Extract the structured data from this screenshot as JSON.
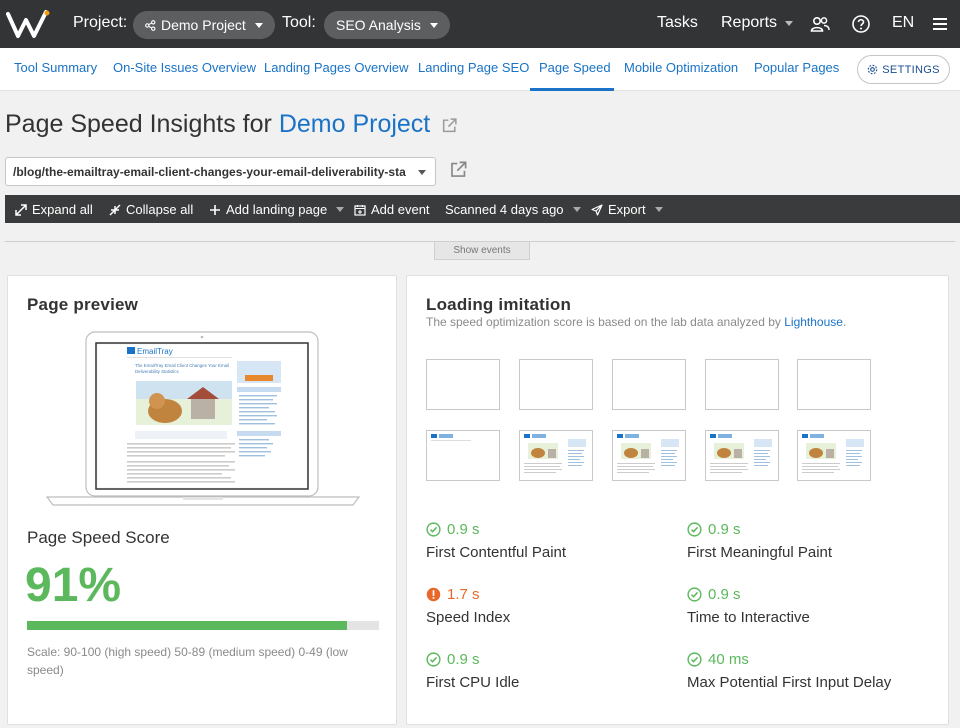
{
  "topbar": {
    "project_label": "Project:",
    "project_value": "Demo Project",
    "tool_label": "Tool:",
    "tool_value": "SEO Analysis",
    "tasks": "Tasks",
    "reports": "Reports",
    "language": "EN"
  },
  "tabs": [
    {
      "label": "Tool Summary"
    },
    {
      "label": "On-Site Issues Overview"
    },
    {
      "label": "Landing Pages Overview"
    },
    {
      "label": "Landing Page SEO"
    },
    {
      "label": "Page Speed"
    },
    {
      "label": "Mobile Optimization"
    },
    {
      "label": "Popular Pages"
    }
  ],
  "active_tab": "Page Speed",
  "settings_label": "SETTINGS",
  "heading": {
    "prefix": "Page Speed Insights for",
    "project": "Demo Project"
  },
  "url_select": {
    "value": "/blog/the-emailtray-email-client-changes-your-email-deliverability-sta"
  },
  "toolbar": {
    "expand_all": "Expand all",
    "collapse_all": "Collapse all",
    "add_landing_page": "Add landing page",
    "add_event": "Add event",
    "scanned": "Scanned 4 days ago",
    "export": "Export"
  },
  "show_events": "Show events",
  "preview": {
    "title": "Page preview",
    "site_name": "EmailTray",
    "article_title": "The EmailTray Email Client Changes Your Email Deliverability Statistics"
  },
  "score": {
    "title": "Page Speed Score",
    "value": "91%",
    "percent": 91,
    "scale_note": "Scale: 90-100 (high speed) 50-89 (medium speed) 0-49 (low speed)"
  },
  "loading": {
    "title": "Loading imitation",
    "subtitle": "The speed optimization score is based on the lab data analyzed by",
    "link": "Lighthouse",
    "period": "."
  },
  "metrics": [
    {
      "value": "0.9 s",
      "label": "First Contentful Paint",
      "status": "good"
    },
    {
      "value": "0.9 s",
      "label": "First Meaningful Paint",
      "status": "good"
    },
    {
      "value": "1.7 s",
      "label": "Speed Index",
      "status": "warn"
    },
    {
      "value": "0.9 s",
      "label": "Time to Interactive",
      "status": "good"
    },
    {
      "value": "0.9 s",
      "label": "First CPU Idle",
      "status": "good"
    },
    {
      "value": "40 ms",
      "label": "Max Potential First Input Delay",
      "status": "good"
    }
  ],
  "colors": {
    "topbar": "#333435",
    "accent": "#1a73c6",
    "good": "#5cb85c",
    "warn": "#e8682a"
  }
}
